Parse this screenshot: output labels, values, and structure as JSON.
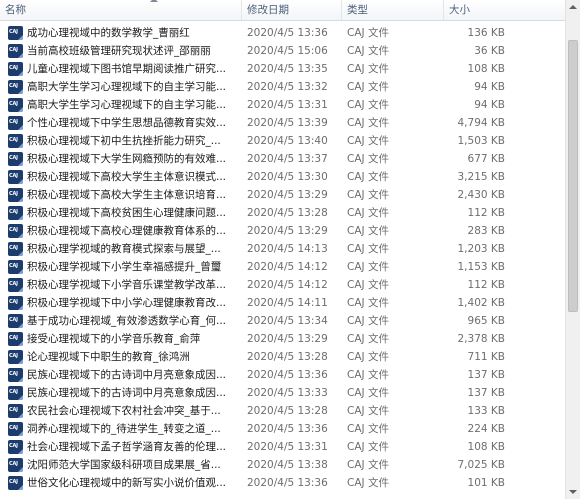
{
  "header": {
    "name": "名称",
    "date": "修改日期",
    "type": "类型",
    "size": "大小"
  },
  "files": [
    {
      "name": "成功心理视域中的数学教学_曹丽红",
      "date": "2020/4/5 13:36",
      "type": "CAJ 文件",
      "size": "136 KB"
    },
    {
      "name": "当前高校班级管理研究现状述评_邵丽丽",
      "date": "2020/4/5 15:06",
      "type": "CAJ 文件",
      "size": "36 KB"
    },
    {
      "name": "儿童心理视域下图书馆早期阅读推广研究...",
      "date": "2020/4/5 13:35",
      "type": "CAJ 文件",
      "size": "108 KB"
    },
    {
      "name": "高职大学生学习心理视域下的自主学习能...",
      "date": "2020/4/5 13:32",
      "type": "CAJ 文件",
      "size": "94 KB"
    },
    {
      "name": "高职大学生学习心理视域下的自主学习能...",
      "date": "2020/4/5 13:31",
      "type": "CAJ 文件",
      "size": "94 KB"
    },
    {
      "name": "个性心理视域下中学生思想品德教育实效...",
      "date": "2020/4/5 13:39",
      "type": "CAJ 文件",
      "size": "4,794 KB"
    },
    {
      "name": "积极心理视域下初中生抗挫折能力研究_...",
      "date": "2020/4/5 13:40",
      "type": "CAJ 文件",
      "size": "1,503 KB"
    },
    {
      "name": "积极心理视域下大学生网瘾预防的有效难...",
      "date": "2020/4/5 13:37",
      "type": "CAJ 文件",
      "size": "677 KB"
    },
    {
      "name": "积极心理视域下高校大学生主体意识模式...",
      "date": "2020/4/5 13:30",
      "type": "CAJ 文件",
      "size": "3,215 KB"
    },
    {
      "name": "积极心理视域下高校大学生主体意识培育...",
      "date": "2020/4/5 13:29",
      "type": "CAJ 文件",
      "size": "2,430 KB"
    },
    {
      "name": "积极心理视域下高校贫困生心理健康问题...",
      "date": "2020/4/5 13:28",
      "type": "CAJ 文件",
      "size": "112 KB"
    },
    {
      "name": "积极心理视域下高校心理健康教育体系的...",
      "date": "2020/4/5 13:29",
      "type": "CAJ 文件",
      "size": "283 KB"
    },
    {
      "name": "积极心理学视域的教育模式探索与展望_...",
      "date": "2020/4/5 14:13",
      "type": "CAJ 文件",
      "size": "1,203 KB"
    },
    {
      "name": "积极心理学视域下小学生幸福感提升_曾璽",
      "date": "2020/4/5 14:12",
      "type": "CAJ 文件",
      "size": "1,153 KB"
    },
    {
      "name": "积极心理学视域下小学音乐课堂教学改革...",
      "date": "2020/4/5 14:12",
      "type": "CAJ 文件",
      "size": "112 KB"
    },
    {
      "name": "积极心理学视域下中小学心理健康教育改...",
      "date": "2020/4/5 14:11",
      "type": "CAJ 文件",
      "size": "1,402 KB"
    },
    {
      "name": "基于成功心理视域_有效渗透数学心育_何...",
      "date": "2020/4/5 13:34",
      "type": "CAJ 文件",
      "size": "965 KB"
    },
    {
      "name": "接受心理视域下的小学音乐教育_俞萍",
      "date": "2020/4/5 13:29",
      "type": "CAJ 文件",
      "size": "2,378 KB"
    },
    {
      "name": "论心理视域下中职生的教育_徐鸿洲",
      "date": "2020/4/5 13:28",
      "type": "CAJ 文件",
      "size": "711 KB"
    },
    {
      "name": "民族心理视域下的古诗词中月亮意象成因...",
      "date": "2020/4/5 13:36",
      "type": "CAJ 文件",
      "size": "137 KB"
    },
    {
      "name": "民族心理视域下的古诗词中月亮意象成因...",
      "date": "2020/4/5 13:33",
      "type": "CAJ 文件",
      "size": "137 KB"
    },
    {
      "name": "农民社会心理视域下农村社会冲突_基于...",
      "date": "2020/4/5 13:28",
      "type": "CAJ 文件",
      "size": "133 KB"
    },
    {
      "name": "洞养心理视域下的_待进学生_转变之道_...",
      "date": "2020/4/5 13:36",
      "type": "CAJ 文件",
      "size": "224 KB"
    },
    {
      "name": "社会心理视域下孟子哲学涵育友善的伦理...",
      "date": "2020/4/5 13:31",
      "type": "CAJ 文件",
      "size": "108 KB"
    },
    {
      "name": "沈阳师范大学国家级科研项目成果展_省...",
      "date": "2020/4/5 13:38",
      "type": "CAJ 文件",
      "size": "7,025 KB"
    },
    {
      "name": "世俗文化心理视域中的新写实小说价值观...",
      "date": "2020/4/5 13:36",
      "type": "CAJ 文件",
      "size": "101 KB"
    }
  ],
  "icons": {
    "file": "caj-file-icon",
    "icon_label": "CAJ"
  },
  "colors": {
    "header_text": "#4c607a",
    "icon_bg": "#1d3c6e",
    "meta_text": "#6d6d6d"
  }
}
